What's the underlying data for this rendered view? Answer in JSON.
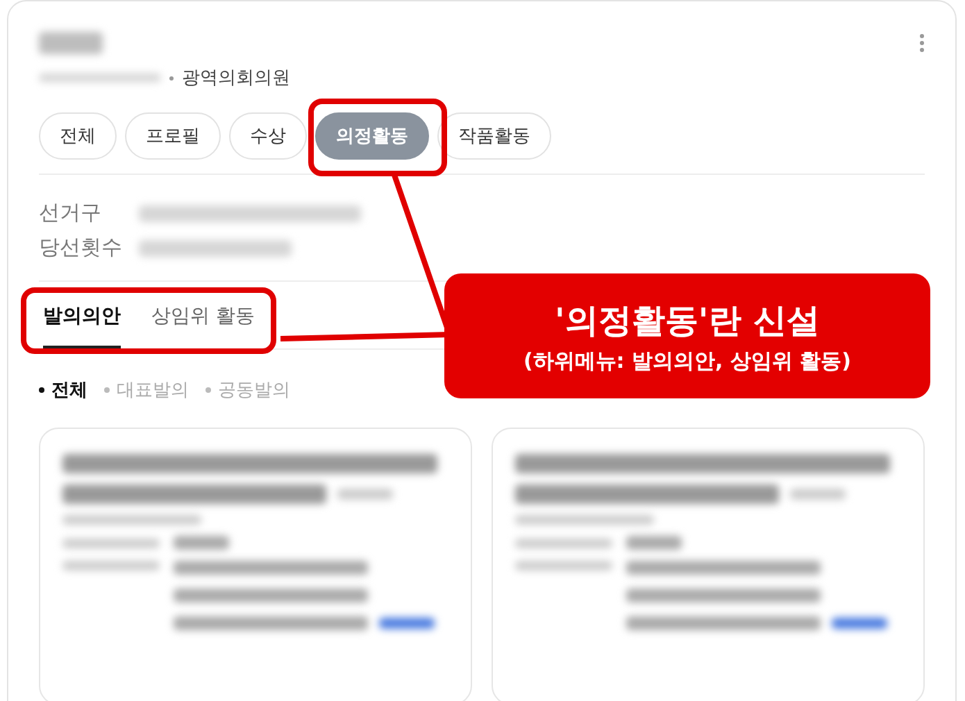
{
  "profile": {
    "role": "광역의회의원"
  },
  "tabs": [
    {
      "label": "전체",
      "selected": false
    },
    {
      "label": "프로필",
      "selected": false
    },
    {
      "label": "수상",
      "selected": false
    },
    {
      "label": "의정활동",
      "selected": true
    },
    {
      "label": "작품활동",
      "selected": false
    }
  ],
  "info": [
    {
      "label": "선거구"
    },
    {
      "label": "당선횟수"
    }
  ],
  "subtabs": [
    {
      "label": "발의의안",
      "selected": true
    },
    {
      "label": "상임위 활동",
      "selected": false
    }
  ],
  "filters": [
    {
      "label": "전체",
      "selected": true
    },
    {
      "label": "대표발의",
      "selected": false
    },
    {
      "label": "공동발의",
      "selected": false
    }
  ],
  "cards": [
    {
      "kind": "blurred"
    },
    {
      "kind": "blurred"
    }
  ],
  "annotation": {
    "title": "'의정활동'란 신설",
    "subtitle": "(하위메뉴: 발의의안, 상임위 활동)"
  }
}
